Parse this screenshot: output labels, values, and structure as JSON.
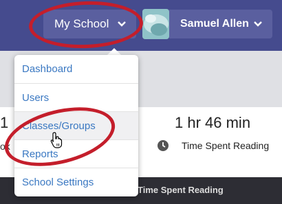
{
  "nav": {
    "school_label": "My School",
    "user_name": "Samuel Allen",
    "bg_color": "#454b8e"
  },
  "dropdown": {
    "items": [
      {
        "label": "Dashboard"
      },
      {
        "label": "Users"
      },
      {
        "label": "Classes/Groups"
      },
      {
        "label": "Reports"
      },
      {
        "label": "School Settings"
      }
    ],
    "hovered_item": "Classes/Groups",
    "link_color": "#3a78c2"
  },
  "stats": {
    "left_value_fragment": "1",
    "left_label_fragment": "ok",
    "time_value": "1 hr 46 min",
    "time_label": "Time Spent Reading"
  },
  "table": {
    "header_label": "Time Spent Reading"
  },
  "annotation": {
    "ring_color": "#c41e2b"
  }
}
